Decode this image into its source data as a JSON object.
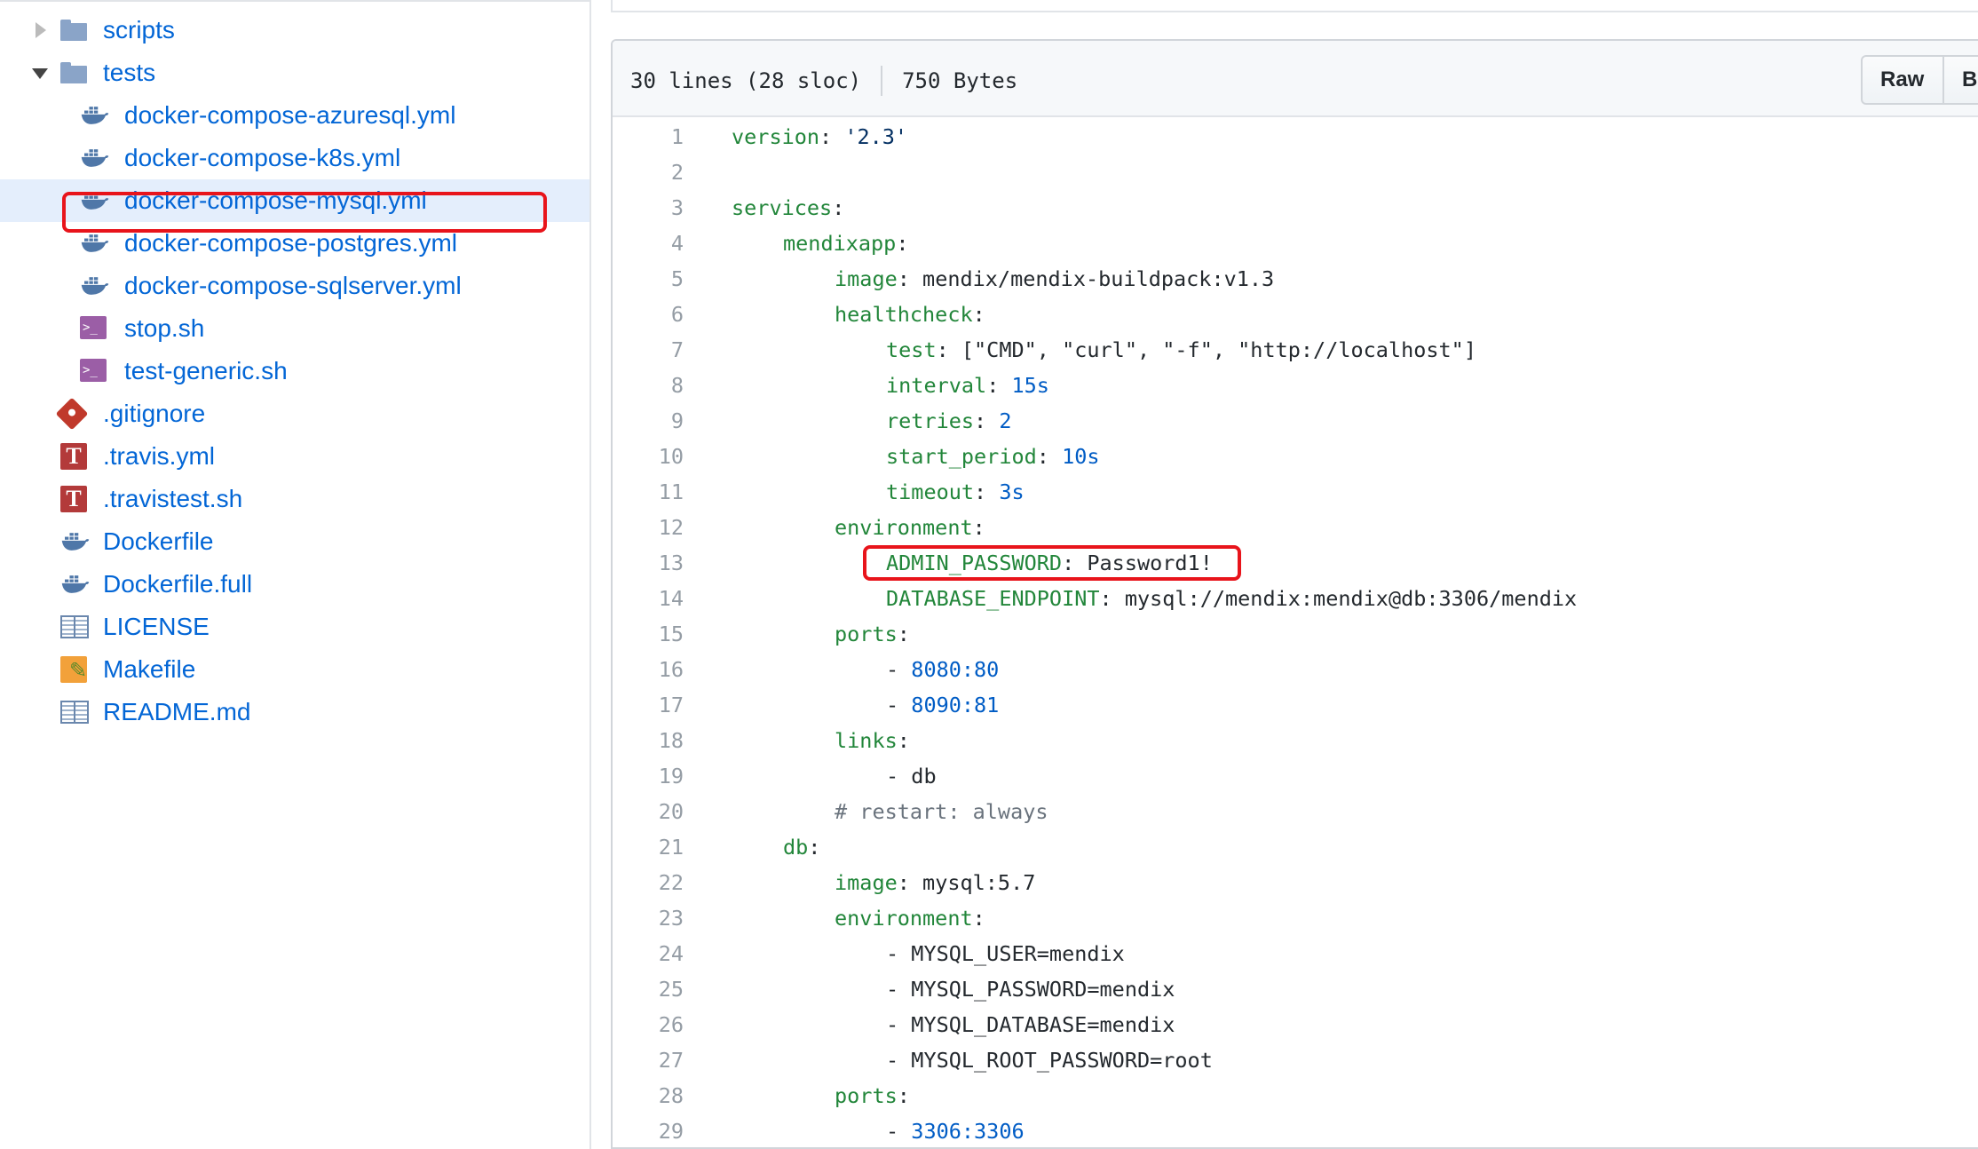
{
  "tree": {
    "items": [
      {
        "label": "scripts",
        "icon": "folder-icon",
        "indent": 1,
        "caret": "collapsed"
      },
      {
        "label": "tests",
        "icon": "folder-icon",
        "indent": 1,
        "caret": "expanded"
      },
      {
        "label": "docker-compose-azuresql.yml",
        "icon": "docker-icon",
        "indent": 2
      },
      {
        "label": "docker-compose-k8s.yml",
        "icon": "docker-icon",
        "indent": 2
      },
      {
        "label": "docker-compose-mysql.yml",
        "icon": "docker-icon",
        "indent": 2,
        "selected": true
      },
      {
        "label": "docker-compose-postgres.yml",
        "icon": "docker-icon",
        "indent": 2
      },
      {
        "label": "docker-compose-sqlserver.yml",
        "icon": "docker-icon",
        "indent": 2
      },
      {
        "label": "stop.sh",
        "icon": "terminal-icon",
        "indent": 2
      },
      {
        "label": "test-generic.sh",
        "icon": "terminal-icon",
        "indent": 2
      },
      {
        "label": ".gitignore",
        "icon": "git-icon",
        "indent": 1
      },
      {
        "label": ".travis.yml",
        "icon": "travis-icon",
        "indent": 1
      },
      {
        "label": ".travistest.sh",
        "icon": "travis-icon",
        "indent": 1
      },
      {
        "label": "Dockerfile",
        "icon": "docker-icon",
        "indent": 1
      },
      {
        "label": "Dockerfile.full",
        "icon": "docker-icon",
        "indent": 1
      },
      {
        "label": "LICENSE",
        "icon": "book-icon",
        "indent": 1
      },
      {
        "label": "Makefile",
        "icon": "makefile-icon",
        "indent": 1
      },
      {
        "label": "README.md",
        "icon": "book-icon",
        "indent": 1
      }
    ]
  },
  "file": {
    "lines_info": "30 lines (28 sloc)",
    "size_info": "750 Bytes",
    "raw_label": "Raw",
    "blame_label": "Bl"
  },
  "code_lines": [
    {
      "n": "1",
      "ind": 0,
      "parts": [
        [
          "k",
          "version"
        ],
        [
          "p",
          ": "
        ],
        [
          "s",
          "'2.3'"
        ]
      ]
    },
    {
      "n": "2",
      "ind": 0,
      "parts": []
    },
    {
      "n": "3",
      "ind": 0,
      "parts": [
        [
          "k",
          "services"
        ],
        [
          "p",
          ":"
        ]
      ]
    },
    {
      "n": "4",
      "ind": 1,
      "parts": [
        [
          "k",
          "mendixapp"
        ],
        [
          "p",
          ":"
        ]
      ]
    },
    {
      "n": "5",
      "ind": 2,
      "parts": [
        [
          "k",
          "image"
        ],
        [
          "p",
          ": mendix/mendix-buildpack:v1.3"
        ]
      ]
    },
    {
      "n": "6",
      "ind": 2,
      "parts": [
        [
          "k",
          "healthcheck"
        ],
        [
          "p",
          ":"
        ]
      ]
    },
    {
      "n": "7",
      "ind": 3,
      "parts": [
        [
          "k",
          "test"
        ],
        [
          "p",
          ": [\"CMD\", \"curl\", \"-f\", \"http://localhost\"]"
        ]
      ]
    },
    {
      "n": "8",
      "ind": 3,
      "parts": [
        [
          "k",
          "interval"
        ],
        [
          "p",
          ": "
        ],
        [
          "n",
          "15s"
        ]
      ]
    },
    {
      "n": "9",
      "ind": 3,
      "parts": [
        [
          "k",
          "retries"
        ],
        [
          "p",
          ": "
        ],
        [
          "n",
          "2"
        ]
      ]
    },
    {
      "n": "10",
      "ind": 3,
      "parts": [
        [
          "k",
          "start_period"
        ],
        [
          "p",
          ": "
        ],
        [
          "n",
          "10s"
        ]
      ]
    },
    {
      "n": "11",
      "ind": 3,
      "parts": [
        [
          "k",
          "timeout"
        ],
        [
          "p",
          ": "
        ],
        [
          "n",
          "3s"
        ]
      ]
    },
    {
      "n": "12",
      "ind": 2,
      "parts": [
        [
          "k",
          "environment"
        ],
        [
          "p",
          ":"
        ]
      ]
    },
    {
      "n": "13",
      "ind": 3,
      "parts": [
        [
          "k",
          "ADMIN_PASSWORD"
        ],
        [
          "p",
          ": Password1!"
        ]
      ]
    },
    {
      "n": "14",
      "ind": 3,
      "parts": [
        [
          "k",
          "DATABASE_ENDPOINT"
        ],
        [
          "p",
          ": mysql://mendix:mendix@db:3306/mendix"
        ]
      ]
    },
    {
      "n": "15",
      "ind": 2,
      "parts": [
        [
          "k",
          "ports"
        ],
        [
          "p",
          ":"
        ]
      ]
    },
    {
      "n": "16",
      "ind": 3,
      "parts": [
        [
          "p",
          "- "
        ],
        [
          "n",
          "8080:80"
        ]
      ]
    },
    {
      "n": "17",
      "ind": 3,
      "parts": [
        [
          "p",
          "- "
        ],
        [
          "n",
          "8090:81"
        ]
      ]
    },
    {
      "n": "18",
      "ind": 2,
      "parts": [
        [
          "k",
          "links"
        ],
        [
          "p",
          ":"
        ]
      ]
    },
    {
      "n": "19",
      "ind": 3,
      "parts": [
        [
          "p",
          "- db"
        ]
      ]
    },
    {
      "n": "20",
      "ind": 2,
      "parts": [
        [
          "c",
          "# restart: always"
        ]
      ]
    },
    {
      "n": "21",
      "ind": 1,
      "parts": [
        [
          "k",
          "db"
        ],
        [
          "p",
          ":"
        ]
      ]
    },
    {
      "n": "22",
      "ind": 2,
      "parts": [
        [
          "k",
          "image"
        ],
        [
          "p",
          ": mysql:5.7"
        ]
      ]
    },
    {
      "n": "23",
      "ind": 2,
      "parts": [
        [
          "k",
          "environment"
        ],
        [
          "p",
          ":"
        ]
      ]
    },
    {
      "n": "24",
      "ind": 3,
      "parts": [
        [
          "p",
          "- MYSQL_USER=mendix"
        ]
      ]
    },
    {
      "n": "25",
      "ind": 3,
      "parts": [
        [
          "p",
          "- MYSQL_PASSWORD=mendix"
        ]
      ]
    },
    {
      "n": "26",
      "ind": 3,
      "parts": [
        [
          "p",
          "- MYSQL_DATABASE=mendix"
        ]
      ]
    },
    {
      "n": "27",
      "ind": 3,
      "parts": [
        [
          "p",
          "- MYSQL_ROOT_PASSWORD=root"
        ]
      ]
    },
    {
      "n": "28",
      "ind": 2,
      "parts": [
        [
          "k",
          "ports"
        ],
        [
          "p",
          ":"
        ]
      ]
    },
    {
      "n": "29",
      "ind": 3,
      "parts": [
        [
          "p",
          "- "
        ],
        [
          "n",
          "3306:3306"
        ]
      ]
    }
  ],
  "annotations": {
    "highlight_color": "#e8141b"
  }
}
